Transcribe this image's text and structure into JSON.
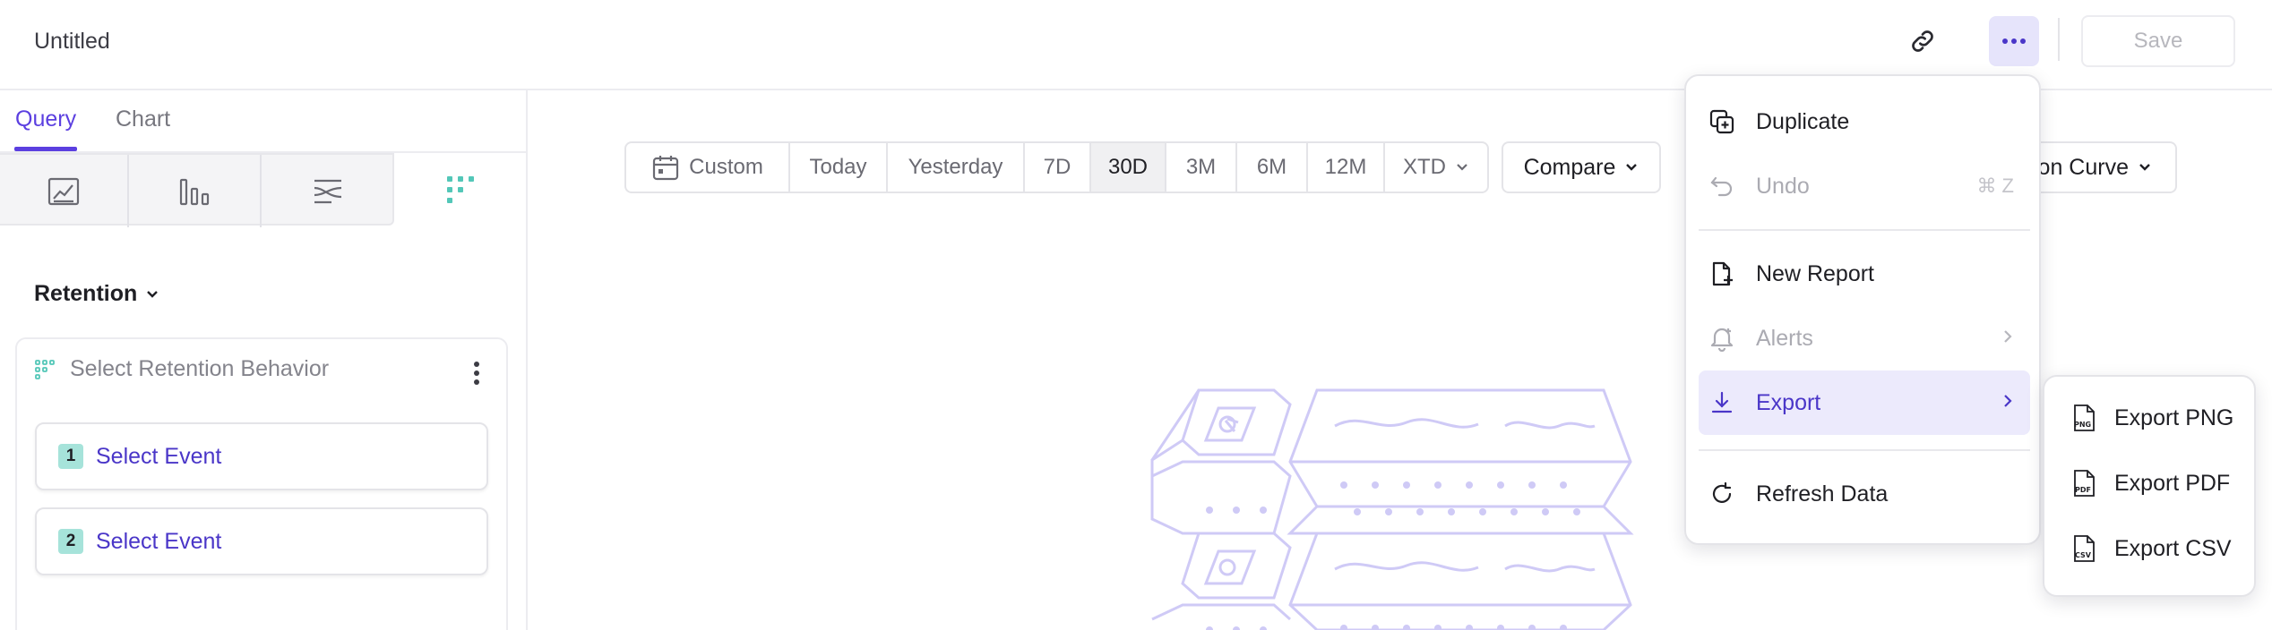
{
  "header": {
    "title": "Untitled",
    "save_label": "Save"
  },
  "left_panel": {
    "tabs": [
      {
        "label": "Query",
        "active": true
      },
      {
        "label": "Chart",
        "active": false
      }
    ],
    "chart_types": [
      "insights-icon",
      "bar-chart-icon",
      "funnel-flow-icon",
      "retention-dots-icon"
    ],
    "section_title": "Retention",
    "behavior_label": "Select Retention Behavior",
    "events": [
      {
        "number": "1",
        "label": "Select Event"
      },
      {
        "number": "2",
        "label": "Select Event"
      }
    ]
  },
  "date_bar": {
    "segments": [
      {
        "label": "Custom",
        "icon": "calendar-icon"
      },
      {
        "label": "Today"
      },
      {
        "label": "Yesterday"
      },
      {
        "label": "7D"
      },
      {
        "label": "30D",
        "active": true
      },
      {
        "label": "3M"
      },
      {
        "label": "6M"
      },
      {
        "label": "12M"
      },
      {
        "label": "XTD",
        "dropdown": true
      }
    ],
    "compare_label": "Compare",
    "curve_label": "on Curve"
  },
  "menu": {
    "items": [
      {
        "label": "Duplicate",
        "icon": "duplicate-icon"
      },
      {
        "label": "Undo",
        "icon": "undo-icon",
        "shortcut": "⌘ Z",
        "disabled": true
      },
      {
        "label": "New Report",
        "icon": "new-report-icon"
      },
      {
        "label": "Alerts",
        "icon": "bell-icon",
        "disabled": true
      },
      {
        "label": "Export",
        "icon": "download-icon",
        "active": true
      },
      {
        "label": "Refresh Data",
        "icon": "refresh-icon"
      }
    ]
  },
  "export_submenu": {
    "items": [
      {
        "label": "Export PNG",
        "icon": "png-file-icon"
      },
      {
        "label": "Export PDF",
        "icon": "pdf-file-icon"
      },
      {
        "label": "Export CSV",
        "icon": "csv-file-icon"
      }
    ]
  },
  "colors": {
    "accent": "#5b3fe0",
    "accent_soft": "#e6e4fb",
    "teal": "#53c7b8",
    "illustration": "#cfcaf6"
  }
}
